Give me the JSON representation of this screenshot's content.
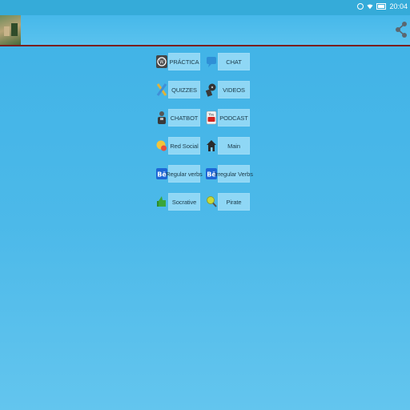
{
  "status_bar": {
    "time": "20:04"
  },
  "menu": {
    "items": [
      {
        "label": "PRÁCTICA",
        "icon": "wordpress-icon"
      },
      {
        "label": "CHAT",
        "icon": "chat-bubble-icon"
      },
      {
        "label": "QUIZZES",
        "icon": "pencil-ruler-icon"
      },
      {
        "label": "VIDEOS",
        "icon": "film-reel-icon"
      },
      {
        "label": "CHATBOT",
        "icon": "robot-figure-icon"
      },
      {
        "label": "PODCAST",
        "icon": "youtube-icon"
      },
      {
        "label": "Red Social",
        "icon": "speech-bubbles-icon"
      },
      {
        "label": "Main",
        "icon": "home-icon"
      },
      {
        "label": "Regular verbs",
        "icon": "behance-icon"
      },
      {
        "label": "Irregular Verbs",
        "icon": "behance-icon"
      },
      {
        "label": "Socrative",
        "icon": "thumbs-up-icon"
      },
      {
        "label": "Pirate",
        "icon": "magnifier-icon"
      }
    ]
  },
  "colors": {
    "background": "#45b6e8",
    "button": "#8fd7f5",
    "appbar_border": "#7a1f1f"
  }
}
